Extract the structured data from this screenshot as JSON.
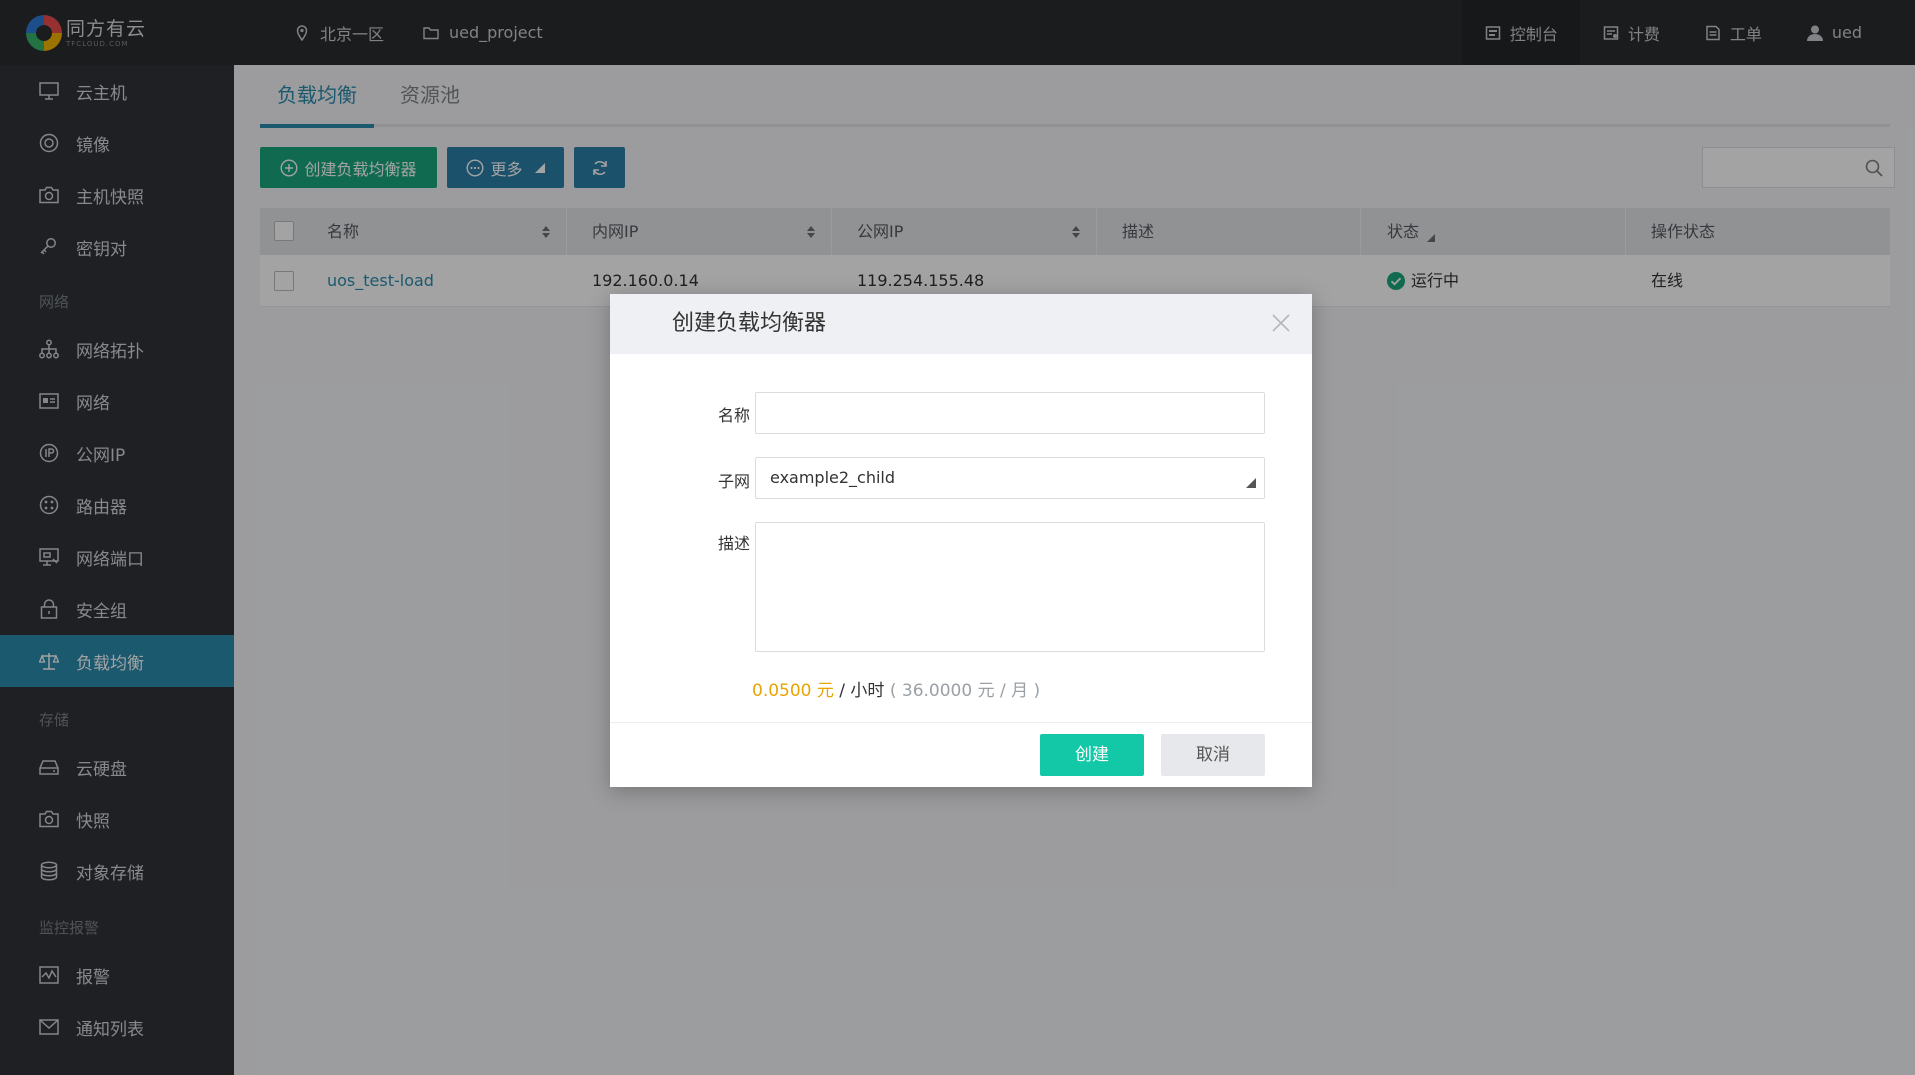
{
  "topbar": {
    "brand_name": "同方有云",
    "brand_sub": "TFCLOUD.COM",
    "region": "北京一区",
    "project": "ued_project",
    "console": "控制台",
    "billing": "计费",
    "ticket": "工单",
    "user": "ued"
  },
  "sidebar": {
    "items": [
      {
        "label": "云主机",
        "icon": "monitor-icon"
      },
      {
        "label": "镜像",
        "icon": "disc-icon"
      },
      {
        "label": "主机快照",
        "icon": "camera-icon"
      },
      {
        "label": "密钥对",
        "icon": "key-icon"
      }
    ],
    "group_network": "网络",
    "network_items": [
      {
        "label": "网络拓扑",
        "icon": "topology-icon"
      },
      {
        "label": "网络",
        "icon": "network-icon"
      },
      {
        "label": "公网IP",
        "icon": "ip-icon"
      },
      {
        "label": "路由器",
        "icon": "router-icon"
      },
      {
        "label": "网络端口",
        "icon": "port-icon"
      },
      {
        "label": "安全组",
        "icon": "lock-icon"
      },
      {
        "label": "负载均衡",
        "icon": "balance-icon"
      }
    ],
    "group_storage": "存储",
    "storage_items": [
      {
        "label": "云硬盘",
        "icon": "disk-icon"
      },
      {
        "label": "快照",
        "icon": "camera-icon"
      },
      {
        "label": "对象存储",
        "icon": "database-icon"
      }
    ],
    "group_monitor": "监控报警",
    "monitor_items": [
      {
        "label": "报警",
        "icon": "alarm-icon"
      },
      {
        "label": "通知列表",
        "icon": "mail-icon"
      }
    ]
  },
  "main": {
    "tabs": [
      "负载均衡",
      "资源池"
    ],
    "toolbar": {
      "create_label": "创建负载均衡器",
      "more_label": "更多"
    },
    "table": {
      "headers": [
        "名称",
        "内网IP",
        "公网IP",
        "描述",
        "状态",
        "操作状态"
      ],
      "rows": [
        {
          "name": "uos_test-load",
          "private_ip": "192.160.0.14",
          "public_ip": "119.254.155.48",
          "desc": "",
          "status": "运行中",
          "op_status": "在线"
        }
      ]
    }
  },
  "modal": {
    "title": "创建负载均衡器",
    "name_label": "名称",
    "name_value": "",
    "subnet_label": "子网",
    "subnet_value": "example2_child",
    "desc_label": "描述",
    "desc_value": "",
    "price_hour": "0.0500 元",
    "price_unit": "/ 小时",
    "price_month": "( 36.0000 元 / 月 )",
    "create_label": "创建",
    "cancel_label": "取消"
  },
  "colors": {
    "accent": "#2b8cae",
    "create_btn": "#12c8a6",
    "price_highlight": "#e8a400",
    "status_ok": "#1aa67e"
  }
}
